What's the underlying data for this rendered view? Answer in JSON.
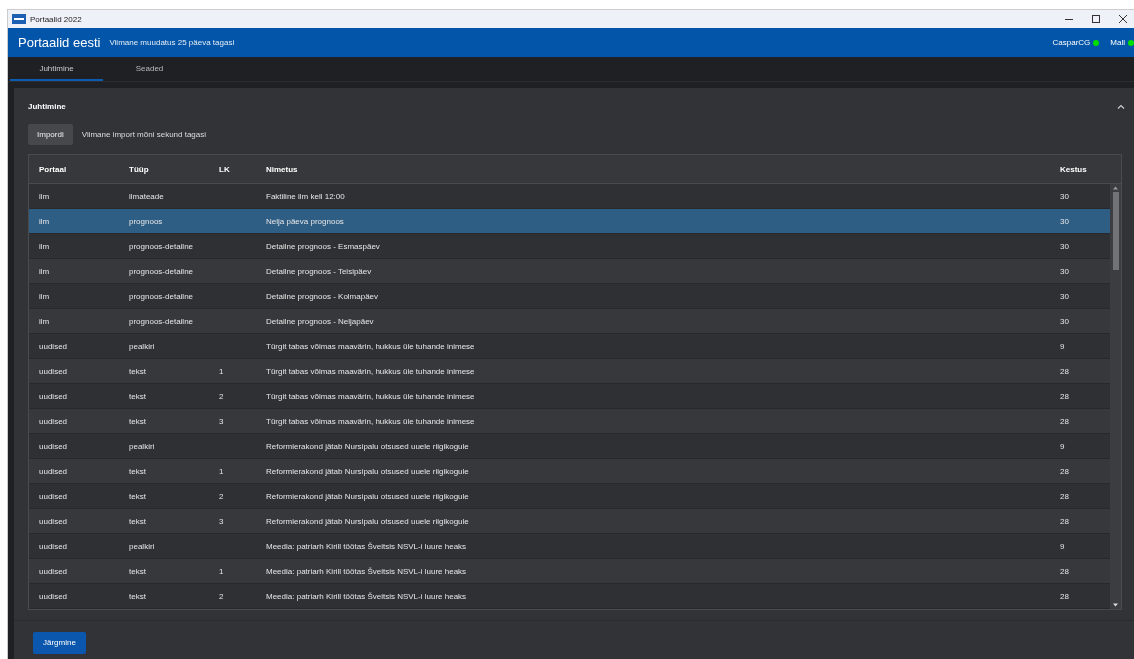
{
  "window": {
    "title": "Portaalid 2022"
  },
  "header": {
    "title": "Portaalid eesti",
    "subtitle": "Viimane muudatus 25 päeva tagasi",
    "connections": [
      {
        "label": "CasparCG",
        "color": "#00e000"
      },
      {
        "label": "Mall",
        "color": "#00e000"
      }
    ]
  },
  "tabs": [
    {
      "label": "Juhtimine",
      "selected": true
    },
    {
      "label": "Seaded",
      "selected": false
    }
  ],
  "panel": {
    "title": "Juhtimine",
    "expanded": true,
    "import_button": "Impordi",
    "import_status": "Viimane import mõni sekund tagasi"
  },
  "table": {
    "columns": [
      "Portaal",
      "Tüüp",
      "LK",
      "Nimetus",
      "Kestus"
    ],
    "rows": [
      {
        "cells": [
          "ilm",
          "ilmateade",
          "",
          "Faktiline ilm kell 12:00",
          "30"
        ],
        "selected": false
      },
      {
        "cells": [
          "ilm",
          "prognoos",
          "",
          "Nelja päeva prognoos",
          "30"
        ],
        "selected": true
      },
      {
        "cells": [
          "ilm",
          "prognoos-detailne",
          "",
          "Detailne prognoos - Esmaspäev",
          "30"
        ],
        "selected": false
      },
      {
        "cells": [
          "ilm",
          "prognoos-detailne",
          "",
          "Detailne prognoos - Teisipäev",
          "30"
        ],
        "selected": false
      },
      {
        "cells": [
          "ilm",
          "prognoos-detailne",
          "",
          "Detailne prognoos - Kolmapäev",
          "30"
        ],
        "selected": false
      },
      {
        "cells": [
          "ilm",
          "prognoos-detailne",
          "",
          "Detailne prognoos - Neljapäev",
          "30"
        ],
        "selected": false
      },
      {
        "cells": [
          "uudised",
          "pealkiri",
          "",
          "Türgit tabas võimas maavärin, hukkus üle tuhande inimese",
          "9"
        ],
        "selected": false
      },
      {
        "cells": [
          "uudised",
          "tekst",
          "1",
          "Türgit tabas võimas maavärin, hukkus üle tuhande inimese",
          "28"
        ],
        "selected": false
      },
      {
        "cells": [
          "uudised",
          "tekst",
          "2",
          "Türgit tabas võimas maavärin, hukkus üle tuhande inimese",
          "28"
        ],
        "selected": false
      },
      {
        "cells": [
          "uudised",
          "tekst",
          "3",
          "Türgit tabas võimas maavärin, hukkus üle tuhande inimese",
          "28"
        ],
        "selected": false
      },
      {
        "cells": [
          "uudised",
          "pealkiri",
          "",
          "Reformierakond jätab Nursipalu otsused uuele riigikogule",
          "9"
        ],
        "selected": false
      },
      {
        "cells": [
          "uudised",
          "tekst",
          "1",
          "Reformierakond jätab Nursipalu otsused uuele riigikogule",
          "28"
        ],
        "selected": false
      },
      {
        "cells": [
          "uudised",
          "tekst",
          "2",
          "Reformierakond jätab Nursipalu otsused uuele riigikogule",
          "28"
        ],
        "selected": false
      },
      {
        "cells": [
          "uudised",
          "tekst",
          "3",
          "Reformierakond jätab Nursipalu otsused uuele riigikogule",
          "28"
        ],
        "selected": false
      },
      {
        "cells": [
          "uudised",
          "pealkiri",
          "",
          "Meedia: patriarh Kirill töötas Šveitsis NSVL-i luure heaks",
          "9"
        ],
        "selected": false
      },
      {
        "cells": [
          "uudised",
          "tekst",
          "1",
          "Meedia: patriarh Kirill töötas Šveitsis NSVL-i luure heaks",
          "28"
        ],
        "selected": false
      },
      {
        "cells": [
          "uudised",
          "tekst",
          "2",
          "Meedia: patriarh Kirill töötas Šveitsis NSVL-i luure heaks",
          "28"
        ],
        "selected": false
      }
    ]
  },
  "footer": {
    "next_button": "Järgmine"
  }
}
